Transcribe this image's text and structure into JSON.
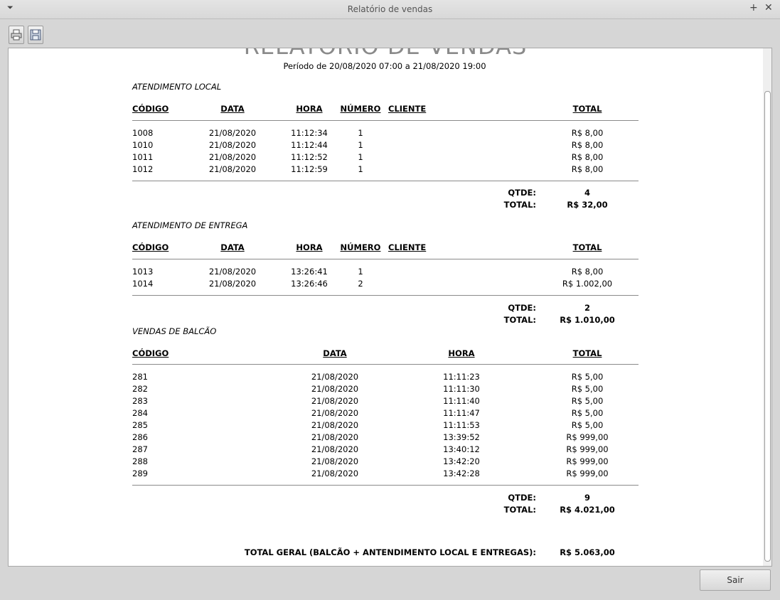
{
  "window": {
    "title": "Relatório de vendas",
    "menu_glyph": "⏷",
    "plus_glyph": "+",
    "close_glyph": "✕"
  },
  "toolbar": {
    "icons": [
      "printer-icon",
      "save-icon"
    ]
  },
  "report": {
    "title": "RELATÓRIO DE VENDAS",
    "period": "Período de 20/08/2020 07:00 a 21/08/2020 19:00",
    "local": {
      "title": "ATENDIMENTO LOCAL",
      "headers": {
        "codigo": "CÓDIGO",
        "data": "DATA",
        "hora": "HORA",
        "numero": "NÚMERO",
        "cliente": "CLIENTE",
        "total": "TOTAL"
      },
      "rows": [
        {
          "codigo": "1008",
          "data": "21/08/2020",
          "hora": "11:12:34",
          "numero": "1",
          "cliente": "",
          "total": "R$ 8,00"
        },
        {
          "codigo": "1010",
          "data": "21/08/2020",
          "hora": "11:12:44",
          "numero": "1",
          "cliente": "",
          "total": "R$ 8,00"
        },
        {
          "codigo": "1011",
          "data": "21/08/2020",
          "hora": "11:12:52",
          "numero": "1",
          "cliente": "",
          "total": "R$ 8,00"
        },
        {
          "codigo": "1012",
          "data": "21/08/2020",
          "hora": "11:12:59",
          "numero": "1",
          "cliente": "",
          "total": "R$ 8,00"
        }
      ],
      "qtde_label": "QTDE:",
      "qtde": "4",
      "total_label": "TOTAL:",
      "total": "R$ 32,00"
    },
    "entrega": {
      "title": "ATENDIMENTO DE ENTREGA",
      "headers": {
        "codigo": "CÓDIGO",
        "data": "DATA",
        "hora": "HORA",
        "numero": "NÚMERO",
        "cliente": "CLIENTE",
        "total": "TOTAL"
      },
      "rows": [
        {
          "codigo": "1013",
          "data": "21/08/2020",
          "hora": "13:26:41",
          "numero": "1",
          "cliente": "",
          "total": "R$ 8,00"
        },
        {
          "codigo": "1014",
          "data": "21/08/2020",
          "hora": "13:26:46",
          "numero": "2",
          "cliente": "",
          "total": "R$ 1.002,00"
        }
      ],
      "qtde_label": "QTDE:",
      "qtde": "2",
      "total_label": "TOTAL:",
      "total": "R$ 1.010,00"
    },
    "balcao": {
      "title": "VENDAS DE BALCÃO",
      "headers": {
        "codigo": "CÓDIGO",
        "data": "DATA",
        "hora": "HORA",
        "total": "TOTAL"
      },
      "rows": [
        {
          "codigo": "281",
          "data": "21/08/2020",
          "hora": "11:11:23",
          "total": "R$ 5,00"
        },
        {
          "codigo": "282",
          "data": "21/08/2020",
          "hora": "11:11:30",
          "total": "R$ 5,00"
        },
        {
          "codigo": "283",
          "data": "21/08/2020",
          "hora": "11:11:40",
          "total": "R$ 5,00"
        },
        {
          "codigo": "284",
          "data": "21/08/2020",
          "hora": "11:11:47",
          "total": "R$ 5,00"
        },
        {
          "codigo": "285",
          "data": "21/08/2020",
          "hora": "11:11:53",
          "total": "R$ 5,00"
        },
        {
          "codigo": "286",
          "data": "21/08/2020",
          "hora": "13:39:52",
          "total": "R$ 999,00"
        },
        {
          "codigo": "287",
          "data": "21/08/2020",
          "hora": "13:40:12",
          "total": "R$ 999,00"
        },
        {
          "codigo": "288",
          "data": "21/08/2020",
          "hora": "13:42:20",
          "total": "R$ 999,00"
        },
        {
          "codigo": "289",
          "data": "21/08/2020",
          "hora": "13:42:28",
          "total": "R$ 999,00"
        }
      ],
      "qtde_label": "QTDE:",
      "qtde": "9",
      "total_label": "TOTAL:",
      "total": "R$ 4.021,00"
    },
    "grand_total_label": "TOTAL GERAL (BALCÃO + ANTENDIMENTO LOCAL E ENTREGAS):",
    "grand_total": "R$ 5.063,00"
  },
  "footer": {
    "exit_label": "Sair"
  }
}
